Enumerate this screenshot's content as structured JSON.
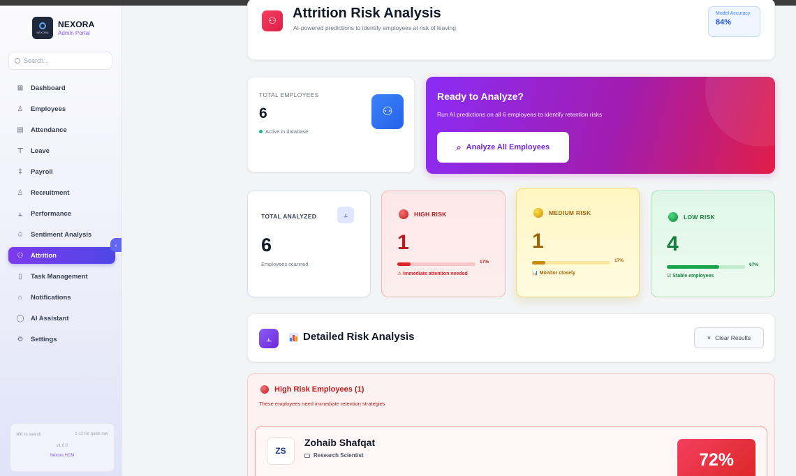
{
  "brand": {
    "name": "NEXORA",
    "subtitle": "Admin Portal",
    "logo_text": "NEXORA"
  },
  "search": {
    "placeholder": "Search..."
  },
  "sidebar": {
    "items": [
      {
        "label": "Dashboard",
        "icon": "grid-icon"
      },
      {
        "label": "Employees",
        "icon": "user-icon"
      },
      {
        "label": "Attendance",
        "icon": "calendar-icon"
      },
      {
        "label": "Leave",
        "icon": "filter-icon"
      },
      {
        "label": "Payroll",
        "icon": "dollar-icon"
      },
      {
        "label": "Recruitment",
        "icon": "user-plus-icon"
      },
      {
        "label": "Performance",
        "icon": "bar-chart-icon"
      },
      {
        "label": "Sentiment Analysis",
        "icon": "smile-icon"
      },
      {
        "label": "Attrition",
        "icon": "users-icon",
        "active": true
      },
      {
        "label": "Task Management",
        "icon": "clipboard-icon"
      },
      {
        "label": "Notifications",
        "icon": "bell-icon"
      },
      {
        "label": "AI Assistant",
        "icon": "chat-icon"
      },
      {
        "label": "Settings",
        "icon": "gear-icon"
      }
    ],
    "footer": {
      "shortcut_search": "⌘K to search",
      "shortcut_nav": "1-12 for quick nav",
      "version": "v1.0.0",
      "product": "Nexora HCM"
    }
  },
  "header": {
    "title": "Attrition Risk Analysis",
    "subtitle": "AI-powered predictions to identify employees at risk of leaving",
    "accuracy_label": "Model Accuracy",
    "accuracy_value": "84%"
  },
  "total_employees": {
    "label": "TOTAL EMPLOYEES",
    "value": "6",
    "status": "Active in database"
  },
  "analyze": {
    "title": "Ready to Analyze?",
    "subtitle": "Run AI predictions on all 6 employees to identify retention risks",
    "button_label": "Analyze All Employees"
  },
  "stats": {
    "total_analyzed": {
      "label": "TOTAL ANALYZED",
      "value": "6",
      "sub": "Employees scanned"
    },
    "high": {
      "label": "HIGH RISK",
      "value": "1",
      "pct": "17%",
      "fraction": 0.17,
      "note": "⚠ Immediate attention needed",
      "color": "#dc2626"
    },
    "medium": {
      "label": "MEDIUM RISK",
      "value": "1",
      "pct": "17%",
      "fraction": 0.17,
      "note": "📊 Monitor closely",
      "color": "#ca8a04"
    },
    "low": {
      "label": "LOW RISK",
      "value": "4",
      "pct": "67%",
      "fraction": 0.67,
      "note": "☑ Stable employees",
      "color": "#16a34a"
    }
  },
  "detail": {
    "title": "Detailed Risk Analysis",
    "clear_label": "Clear Results"
  },
  "high_risk_list": {
    "title": "High Risk Employees (1)",
    "subtitle": "These employees need immediate retention strategies",
    "employees": [
      {
        "initials": "ZS",
        "name": "Zohaib Shafqat",
        "role": "Research Scientist",
        "score": "72%"
      }
    ]
  }
}
